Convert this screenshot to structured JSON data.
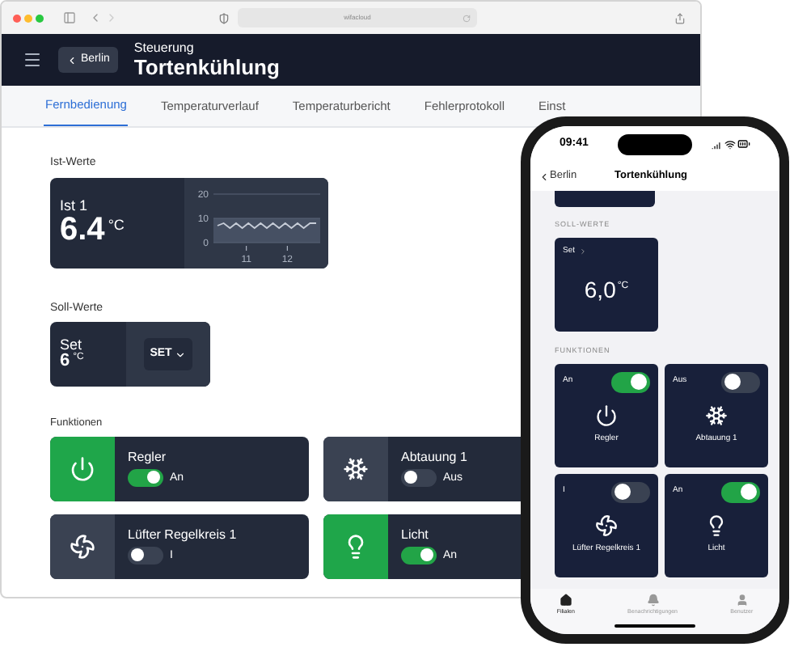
{
  "browser": {
    "url": "wifacloud"
  },
  "header": {
    "back": "Berlin",
    "subtitle": "Steuerung",
    "title": "Tortenkühlung"
  },
  "tabs": [
    {
      "label": "Fernbedienung",
      "selected": true
    },
    {
      "label": "Temperaturverlauf",
      "selected": false
    },
    {
      "label": "Temperaturbericht",
      "selected": false
    },
    {
      "label": "Fehlerprotokoll",
      "selected": false
    },
    {
      "label": "Einst",
      "selected": false
    }
  ],
  "actual": {
    "heading": "Ist-Werte",
    "label": "Ist 1",
    "value": "6.4",
    "unit": "°C",
    "chart_data": {
      "type": "line",
      "x": [
        10.3,
        10.45,
        10.6,
        10.75,
        10.9,
        11.05,
        11.2,
        11.35,
        11.5,
        11.65,
        11.8,
        11.95,
        12.1,
        12.25,
        12.4,
        12.55,
        12.7
      ],
      "series": [
        {
          "color": "#c7cdd8",
          "values": [
            7,
            8,
            6,
            8,
            6,
            8,
            6,
            8,
            6,
            8,
            6,
            8,
            6,
            8,
            6,
            8,
            8
          ]
        }
      ],
      "xlim": [
        10.2,
        12.8
      ],
      "ylim": [
        0,
        20
      ],
      "xticks": [
        11,
        12
      ],
      "yticks": [
        0,
        10,
        20
      ]
    }
  },
  "setpoint": {
    "heading": "Soll-Werte",
    "label": "Set",
    "value": "6",
    "unit": "°C",
    "button": "SET"
  },
  "functions": {
    "heading": "Funktionen",
    "items": [
      {
        "name": "Regler",
        "kind": "power",
        "on": true,
        "status": "An"
      },
      {
        "name": "Abtauung 1",
        "kind": "defrost",
        "on": false,
        "status": "Aus"
      },
      {
        "name": "Lüfter Regelkreis 1",
        "kind": "fan",
        "on": false,
        "status": "I"
      },
      {
        "name": "Licht",
        "kind": "light",
        "on": true,
        "status": "An"
      }
    ]
  },
  "phone": {
    "time": "09:41",
    "back": "Berlin",
    "title": "Tortenkühlung",
    "setpoint": {
      "heading": "SOLL-WERTE",
      "label": "Set",
      "value": "6,0",
      "unit": "°C"
    },
    "functions": {
      "heading": "FUNKTIONEN",
      "items": [
        {
          "name": "Regler",
          "kind": "power",
          "on": true,
          "status": "An"
        },
        {
          "name": "Abtauung 1",
          "kind": "defrost",
          "on": false,
          "status": "Aus"
        },
        {
          "name": "Lüfter Regelkreis 1",
          "kind": "fan",
          "on": false,
          "status": "I"
        },
        {
          "name": "Licht",
          "kind": "light",
          "on": true,
          "status": "An"
        }
      ]
    },
    "tab_bar": [
      {
        "label": "Filialen",
        "kind": "home",
        "selected": true
      },
      {
        "label": "Benachrichtigungen",
        "kind": "bell",
        "selected": false
      },
      {
        "label": "Benutzer",
        "kind": "user",
        "selected": false
      }
    ]
  }
}
